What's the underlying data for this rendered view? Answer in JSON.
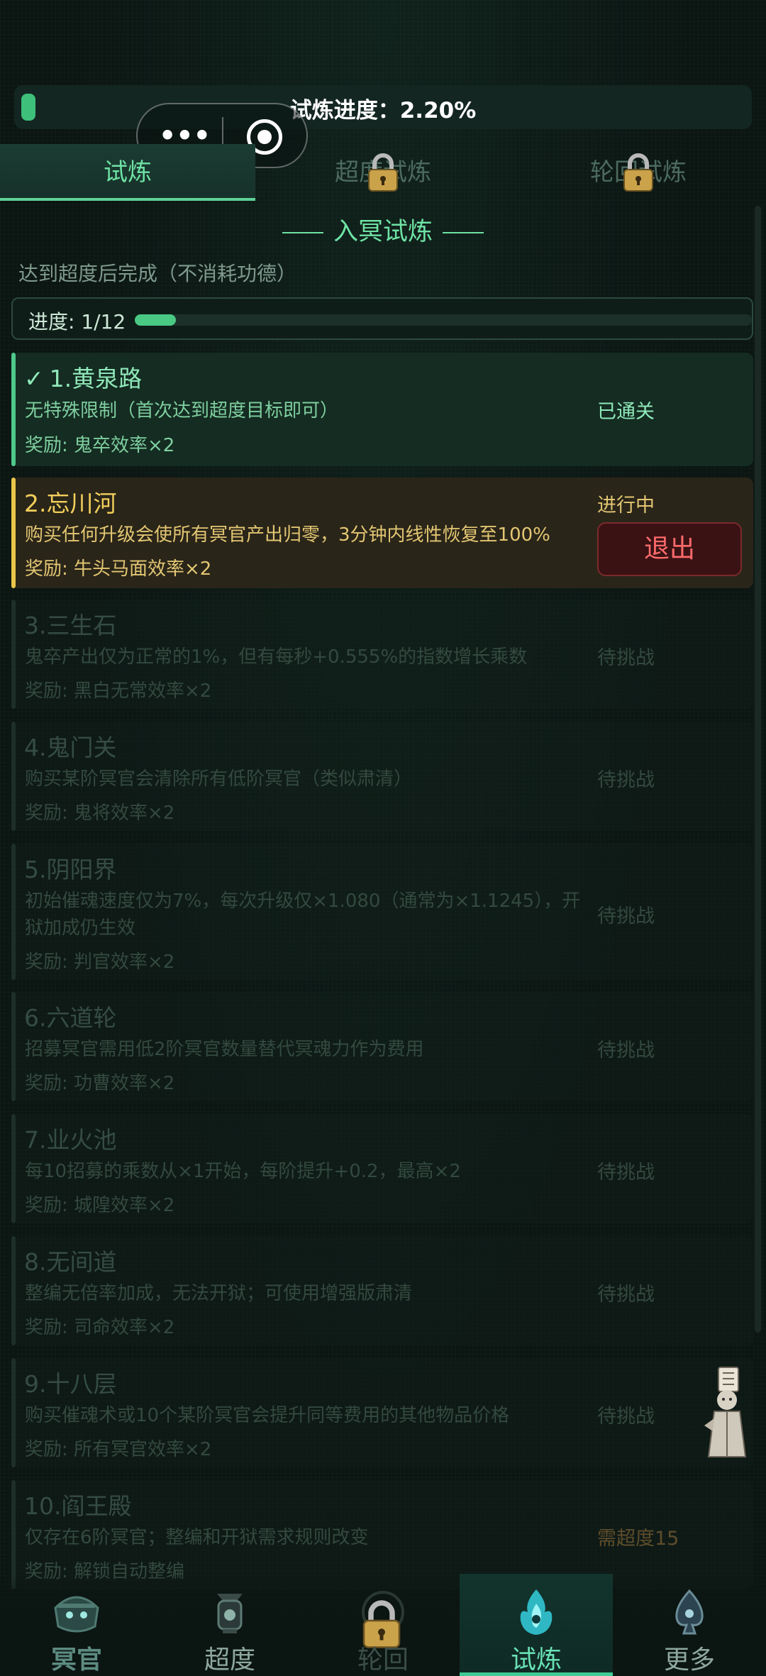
{
  "top": {
    "progress_text": "试炼进度：2.20%",
    "progress_fraction": 0.022
  },
  "capsule": {
    "more_label": "•••"
  },
  "tabs": [
    {
      "label": "试炼",
      "active": true,
      "locked": false
    },
    {
      "label": "超度试炼",
      "active": false,
      "locked": true
    },
    {
      "label": "轮回试炼",
      "active": false,
      "locked": true
    }
  ],
  "section": {
    "title": "入冥试炼",
    "subtitle": "达到超度后完成（不消耗功德）",
    "progress_label": "进度: 1/12",
    "progress_done": 1,
    "progress_total": 12
  },
  "challenges": [
    {
      "title": "1.黄泉路",
      "desc": "无特殊限制（首次达到超度目标即可）",
      "reward": "奖励: 鬼卒效率×2",
      "status": "已通关",
      "state": "passed"
    },
    {
      "title": "2.忘川河",
      "desc": "购买任何升级会使所有冥官产出归零，3分钟内线性恢复至100%",
      "reward": "奖励: 牛头马面效率×2",
      "status": "进行中",
      "state": "current",
      "exit_label": "退出"
    },
    {
      "title": "3.三生石",
      "desc": "鬼卒产出仅为正常的1%，但有每秒+0.555%的指数增长乘数",
      "reward": "奖励: 黑白无常效率×2",
      "status": "待挑战",
      "state": "pending"
    },
    {
      "title": "4.鬼门关",
      "desc": "购买某阶冥官会清除所有低阶冥官（类似肃清）",
      "reward": "奖励: 鬼将效率×2",
      "status": "待挑战",
      "state": "pending"
    },
    {
      "title": "5.阴阳界",
      "desc": "初始催魂速度仅为7%，每次升级仅×1.080（通常为×1.1245），开狱加成仍生效",
      "reward": "奖励: 判官效率×2",
      "status": "待挑战",
      "state": "pending"
    },
    {
      "title": "6.六道轮",
      "desc": "招募冥官需用低2阶冥官数量替代冥魂力作为费用",
      "reward": "奖励: 功曹效率×2",
      "status": "待挑战",
      "state": "pending"
    },
    {
      "title": "7.业火池",
      "desc": "每10招募的乘数从×1开始，每阶提升+0.2，最高×2",
      "reward": "奖励: 城隍效率×2",
      "status": "待挑战",
      "state": "pending"
    },
    {
      "title": "8.无间道",
      "desc": "整编无倍率加成，无法开狱；可使用增强版肃清",
      "reward": "奖励: 司命效率×2",
      "status": "待挑战",
      "state": "pending"
    },
    {
      "title": "9.十八层",
      "desc": "购买催魂术或10个某阶冥官会提升同等费用的其他物品价格",
      "reward": "奖励: 所有冥官效率×2",
      "status": "待挑战",
      "state": "pending"
    },
    {
      "title": "10.阎王殿",
      "desc": "仅存在6阶冥官；整编和开狱需求规则改变",
      "reward": "奖励: 解锁自动整编",
      "status": "需超度15",
      "state": "locked"
    }
  ],
  "nav": [
    {
      "label": "冥官",
      "icon": "ghost-official-icon",
      "active": false,
      "locked": false
    },
    {
      "label": "超度",
      "icon": "lantern-icon",
      "active": false,
      "locked": false
    },
    {
      "label": "轮回",
      "icon": "lock-icon",
      "active": false,
      "locked": true
    },
    {
      "label": "试炼",
      "icon": "blue-flame-icon",
      "active": true,
      "locked": false
    },
    {
      "label": "更多",
      "icon": "spade-flame-icon",
      "active": false,
      "locked": false
    }
  ],
  "colors": {
    "accent": "#6ee2a4",
    "passed": "#4ec88b",
    "current": "#e9c54a",
    "danger": "#ff6b6b",
    "background": "#0b1512"
  }
}
